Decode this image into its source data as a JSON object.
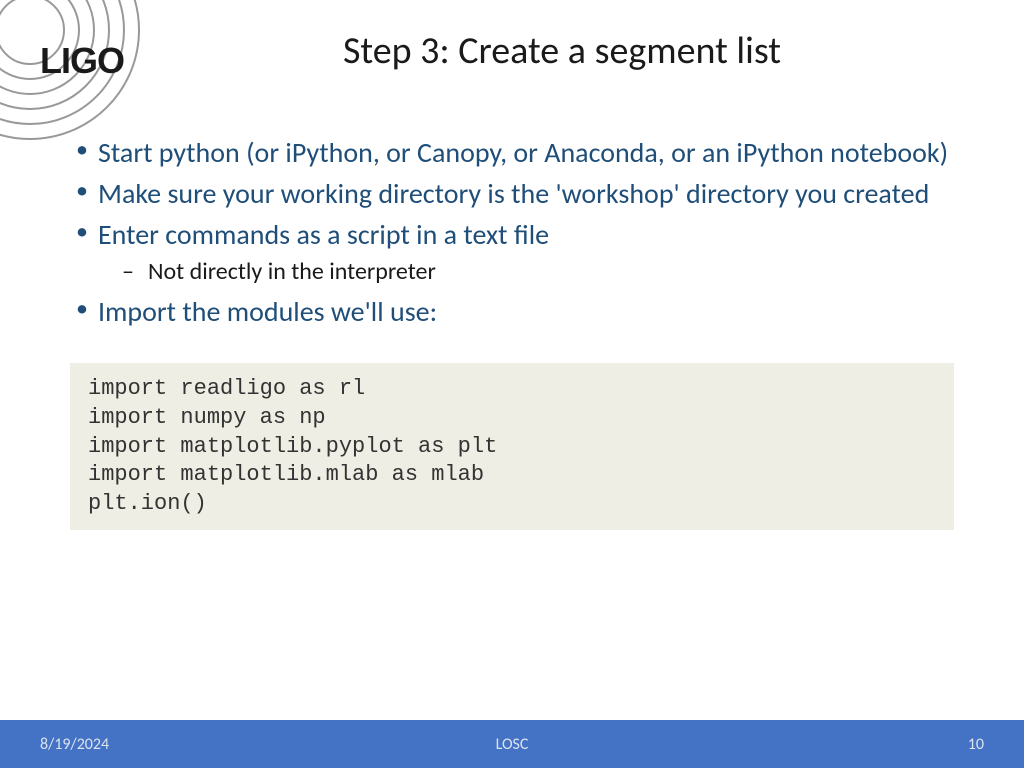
{
  "logo": {
    "text": "LIGO"
  },
  "title": "Step 3: Create a segment list",
  "bullets": [
    {
      "text": "Start python (or iPython, or Canopy, or Anaconda, or an iPython notebook)"
    },
    {
      "text": "Make sure your working directory is the 'workshop' directory you created"
    },
    {
      "text": "Enter commands as a script in a text file",
      "sub": "Not directly in the interpreter"
    },
    {
      "text": "Import the modules we'll use:"
    }
  ],
  "code": "import readligo as rl\nimport numpy as np\nimport matplotlib.pyplot as plt\nimport matplotlib.mlab as mlab\nplt.ion()",
  "footer": {
    "date": "8/19/2024",
    "center": "LOSC",
    "page": "10"
  }
}
